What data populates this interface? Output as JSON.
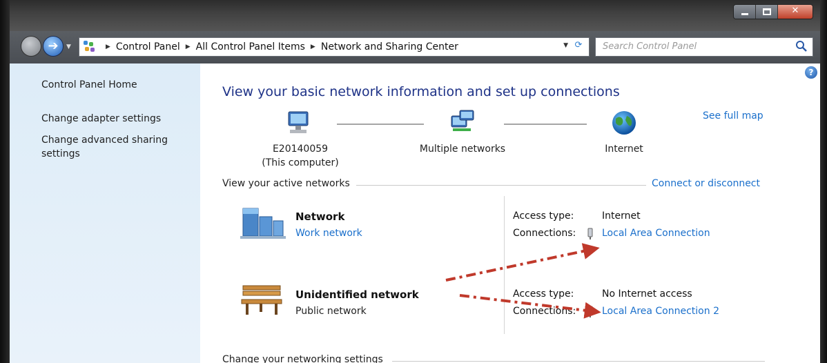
{
  "window": {
    "controls": {
      "minimize_icon": "minimize-icon",
      "maximize_icon": "maximize-icon",
      "close_glyph": "✕"
    }
  },
  "nav": {
    "breadcrumbs": [
      "Control Panel",
      "All Control Panel Items",
      "Network and Sharing Center"
    ],
    "search_placeholder": "Search Control Panel"
  },
  "sidebar": {
    "items": [
      {
        "label": "Control Panel Home"
      },
      {
        "label": "Change adapter settings"
      },
      {
        "label": "Change advanced sharing settings"
      }
    ]
  },
  "main": {
    "help_glyph": "?",
    "title": "View your basic network information and set up connections",
    "see_full_map": "See full map",
    "map": {
      "computer_name": "E20140059",
      "computer_sub": "(This computer)",
      "middle": "Multiple networks",
      "internet": "Internet"
    },
    "active_networks_heading": "View your active networks",
    "connect_or_disconnect": "Connect or disconnect",
    "networks": [
      {
        "name": "Network",
        "type": "Work network",
        "access_type_label": "Access type:",
        "access_type_value": "Internet",
        "connections_label": "Connections:",
        "connections_value": "Local Area Connection"
      },
      {
        "name": "Unidentified network",
        "type": "Public network",
        "access_type_label": "Access type:",
        "access_type_value": "No Internet access",
        "connections_label": "Connections:",
        "connections_value": "Local Area Connection 2"
      }
    ],
    "change_settings_heading": "Change your networking settings"
  },
  "colors": {
    "link": "#1a6fcb",
    "title": "#1e3287",
    "annotation_arrow": "#c0392b"
  }
}
